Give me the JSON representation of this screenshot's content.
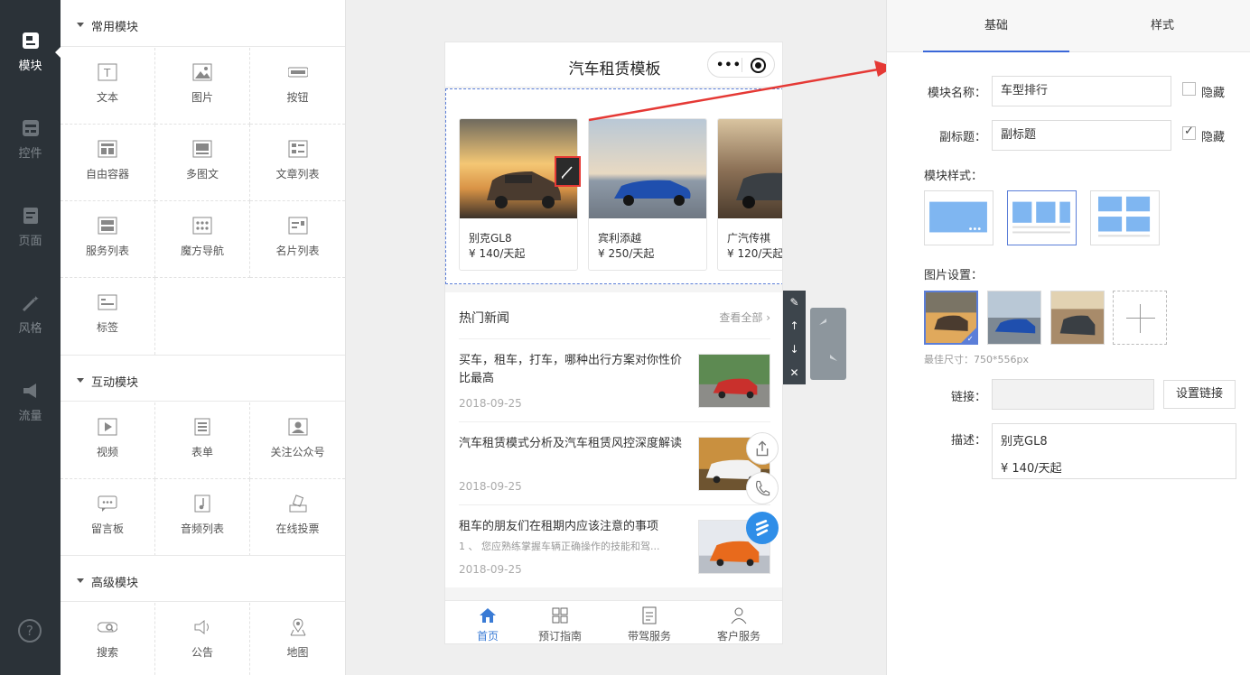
{
  "rail": {
    "items": [
      {
        "label": "模块",
        "icon": "module-icon",
        "active": true
      },
      {
        "label": "控件",
        "icon": "widget-icon"
      },
      {
        "label": "页面",
        "icon": "page-icon"
      },
      {
        "label": "风格",
        "icon": "magic-wand-icon"
      },
      {
        "label": "流量",
        "icon": "megaphone-icon"
      }
    ],
    "help": "?"
  },
  "library": {
    "sections": [
      {
        "title": "常用模块",
        "items": [
          "文本",
          "图片",
          "按钮",
          "自由容器",
          "多图文",
          "文章列表",
          "服务列表",
          "魔方导航",
          "名片列表",
          "标签"
        ]
      },
      {
        "title": "互动模块",
        "items": [
          "视频",
          "表单",
          "关注公众号",
          "留言板",
          "音频列表",
          "在线投票"
        ]
      },
      {
        "title": "高级模块",
        "items": [
          "搜索",
          "公告",
          "地图"
        ]
      }
    ]
  },
  "phone": {
    "title": "汽车租赁模板",
    "capsule_dots": "•••",
    "cars": [
      {
        "name": "别克GL8",
        "price": "¥ 140/天起"
      },
      {
        "name": "宾利添越",
        "price": "¥ 250/天起"
      },
      {
        "name": "广汽传祺",
        "price": "¥ 120/天起"
      }
    ],
    "news": {
      "title": "热门新闻",
      "more": "查看全部",
      "items": [
        {
          "title": "买车，租车，打车，哪种出行方案对你性价比最高",
          "summary": "",
          "date": "2018-09-25"
        },
        {
          "title": "汽车租赁模式分析及汽车租赁风控深度解读",
          "summary": "",
          "date": "2018-09-25"
        },
        {
          "title": "租车的朋友们在租期内应该注意的事项",
          "summary": "1 、 您应熟练掌握车辆正确操作的技能和驾...",
          "date": "2018-09-25"
        }
      ]
    },
    "tabs": [
      {
        "label": "首页",
        "active": true
      },
      {
        "label": "预订指南"
      },
      {
        "label": "带驾服务"
      },
      {
        "label": "客户服务"
      }
    ]
  },
  "props": {
    "tabs": [
      "基础",
      "样式"
    ],
    "module_name_label": "模块名称：",
    "module_name_value": "车型排行",
    "hide_label": "隐藏",
    "subtitle_label": "副标题：",
    "subtitle_value": "副标题",
    "style_label": "模块样式：",
    "image_label": "图片设置：",
    "best_size": "最佳尺寸：750*556px",
    "link_label": "链接：",
    "link_button": "设置链接",
    "desc_label": "描述：",
    "desc_line1": "别克GL8",
    "desc_line2": "¥ 140/天起"
  },
  "colors": {
    "accent": "#3a67d8",
    "rail": "#2b3238",
    "highlight": "#e53935",
    "tile": "#7fb6f1"
  }
}
